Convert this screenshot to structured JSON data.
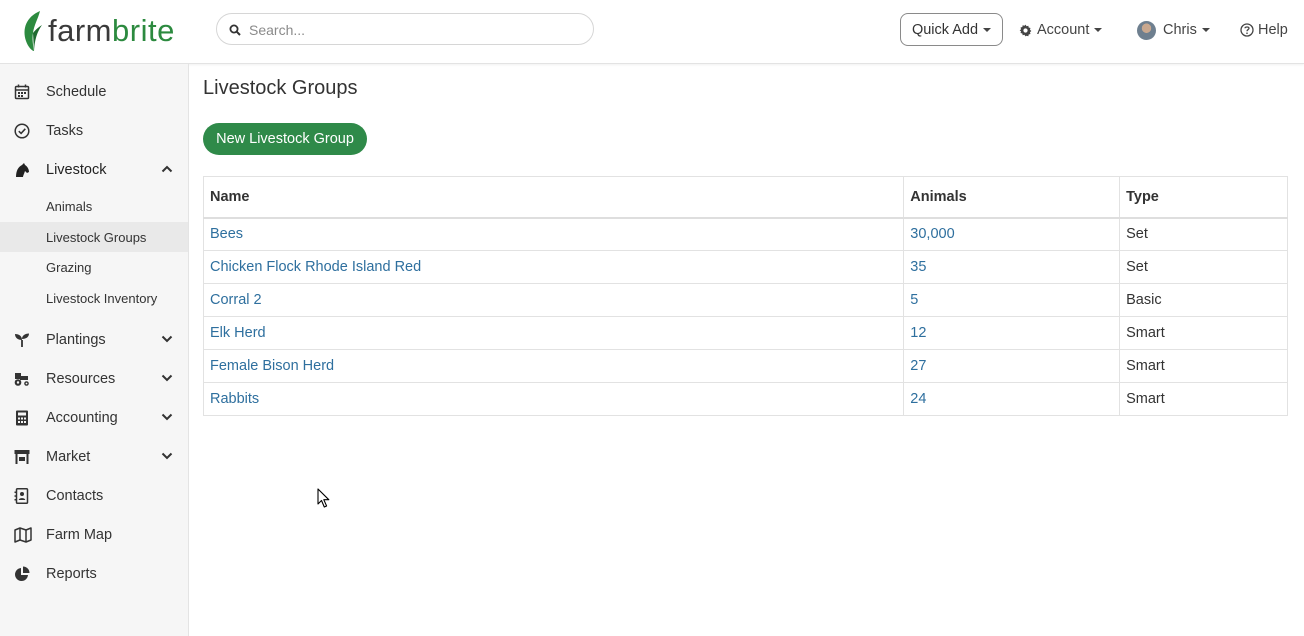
{
  "header": {
    "logo_part1": "farm",
    "logo_part2": "brite",
    "search_placeholder": "Search...",
    "quick_add": "Quick Add",
    "account": "Account",
    "user": "Chris",
    "help": "Help"
  },
  "sidebar": {
    "items": [
      {
        "label": "Schedule",
        "icon": "calendar-icon"
      },
      {
        "label": "Tasks",
        "icon": "check-circle-icon"
      },
      {
        "label": "Livestock",
        "icon": "horse-head-icon"
      },
      {
        "label": "Plantings",
        "icon": "seedling-icon"
      },
      {
        "label": "Resources",
        "icon": "tractor-icon"
      },
      {
        "label": "Accounting",
        "icon": "calculator-icon"
      },
      {
        "label": "Market",
        "icon": "store-icon"
      },
      {
        "label": "Contacts",
        "icon": "address-book-icon"
      },
      {
        "label": "Farm Map",
        "icon": "map-icon"
      },
      {
        "label": "Reports",
        "icon": "pie-chart-icon"
      }
    ],
    "livestock_sub": [
      "Animals",
      "Livestock Groups",
      "Grazing",
      "Livestock Inventory"
    ]
  },
  "main": {
    "title": "Livestock Groups",
    "new_button": "New Livestock Group",
    "columns": [
      "Name",
      "Animals",
      "Type"
    ],
    "rows": [
      {
        "name": "Bees",
        "animals": "30,000",
        "type": "Set"
      },
      {
        "name": "Chicken Flock Rhode Island Red",
        "animals": "35",
        "type": "Set"
      },
      {
        "name": "Corral 2",
        "animals": "5",
        "type": "Basic"
      },
      {
        "name": "Elk Herd",
        "animals": "12",
        "type": "Smart"
      },
      {
        "name": "Female Bison Herd",
        "animals": "27",
        "type": "Smart"
      },
      {
        "name": "Rabbits",
        "animals": "24",
        "type": "Smart"
      }
    ]
  },
  "colors": {
    "brand_green": "#2f8a49",
    "link_blue": "#2e6f9e"
  }
}
